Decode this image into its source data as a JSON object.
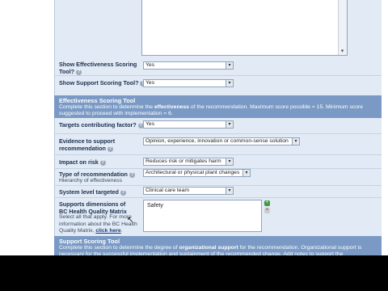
{
  "rows": {
    "show_effectiveness": {
      "label": "Show Effectiveness Scoring Tool?",
      "value": "Yes"
    },
    "show_support": {
      "label": "Show Support Scoring Tool?",
      "value": "Yes"
    },
    "targets": {
      "label": "Targets contributing factor?",
      "value": "Yes"
    },
    "evidence": {
      "label": "Evidence to support recommendation",
      "value": "Opinion, experience, innovation or common-sense solution"
    },
    "impact": {
      "label": "Impact on risk",
      "value": "Reduces risk or mitigates harm"
    },
    "type": {
      "label": "Type of recommendation",
      "sublabel": "Hierarchy of effectiveness",
      "value": "Architectural or physical plant changes"
    },
    "system_level": {
      "label": "System level targeted",
      "value": "Clinical care team"
    },
    "dimensions": {
      "label": "Supports dimensions of BC Health Quality Matrix",
      "help_text": "Select all that apply. For more information about the BC Health Quality Matrix,",
      "link": "click here",
      "link_suffix": ".",
      "selected": "Safety"
    }
  },
  "effectiveness_section": {
    "title": "Effectiveness Scoring Tool",
    "desc_before": "Complete this section to determine the ",
    "desc_bold": "effectiveness",
    "desc_after": " of the recommendation. Maximum score possible = 15. Minimum score suggested to proceed with implementation = 6."
  },
  "support_section": {
    "title": "Support Scoring Tool",
    "desc_before": "Complete this section to determine the degree of ",
    "desc_bold": "organizational support",
    "desc_after": " for the recommendation. Organizational support is necessary for the successful implementation and sustainment of the recommended change. Add notes to support the"
  },
  "icons": {
    "help": "help-icon",
    "dropdown": "chevron-down-icon",
    "add": "add-icon",
    "remove": "remove-icon"
  },
  "colors": {
    "section_header": "#7a9ac5",
    "form_background": "#e2ebf5"
  }
}
